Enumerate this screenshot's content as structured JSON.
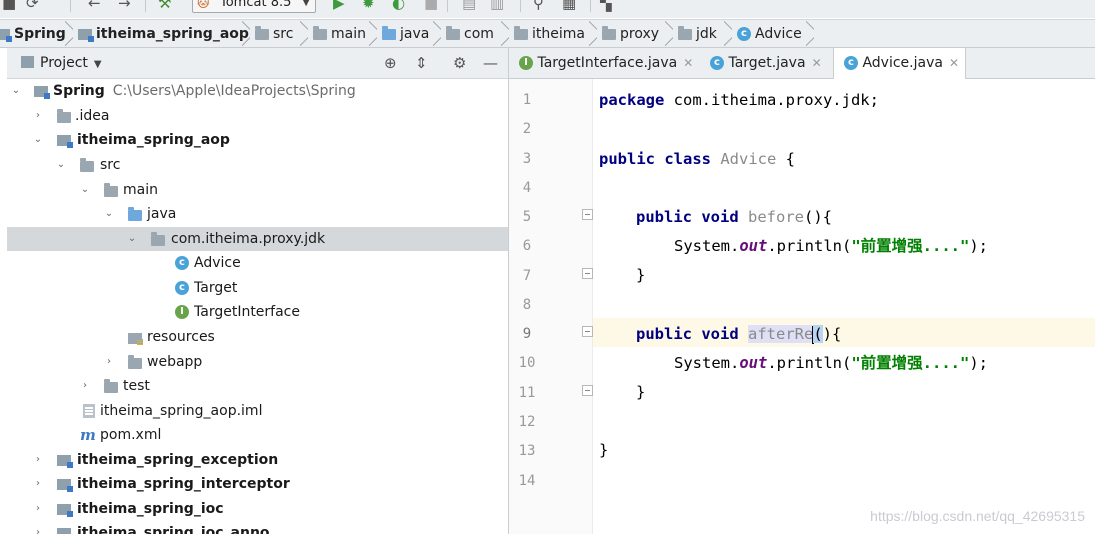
{
  "toolbar": {
    "run_config": "Tomcat 8.5",
    "icons": [
      "save-icon",
      "sync-icon",
      "undo-icon",
      "redo-icon",
      "build-icon",
      "tomcat-icon",
      "run-icon",
      "debug-icon",
      "coverage-icon",
      "stop-icon",
      "project-structure-icon",
      "sdk-icon",
      "search-icon",
      "structure-icon",
      "vcs-icon"
    ]
  },
  "breadcrumb": [
    {
      "label": "Spring",
      "icon": "module",
      "bold": true
    },
    {
      "label": "itheima_spring_aop",
      "icon": "module",
      "bold": true
    },
    {
      "label": "src",
      "icon": "folder"
    },
    {
      "label": "main",
      "icon": "folder"
    },
    {
      "label": "java",
      "icon": "folder-blue"
    },
    {
      "label": "com",
      "icon": "folder"
    },
    {
      "label": "itheima",
      "icon": "folder"
    },
    {
      "label": "proxy",
      "icon": "folder"
    },
    {
      "label": "jdk",
      "icon": "folder"
    },
    {
      "label": "Advice",
      "icon": "class"
    }
  ],
  "project_panel": {
    "title": "Project",
    "tree": [
      {
        "label": "Spring",
        "path": "C:\\Users\\Apple\\IdeaProjects\\Spring",
        "bold": true,
        "icon": "module",
        "expanded": true
      },
      {
        "label": ".idea",
        "icon": "folder",
        "expanded": false
      },
      {
        "label": "itheima_spring_aop",
        "bold": true,
        "icon": "module",
        "expanded": true
      },
      {
        "label": "src",
        "icon": "folder",
        "expanded": true
      },
      {
        "label": "main",
        "icon": "folder",
        "expanded": true
      },
      {
        "label": "java",
        "icon": "folder-blue",
        "expanded": true
      },
      {
        "label": "com.itheima.proxy.jdk",
        "icon": "package",
        "expanded": true,
        "selected": true
      },
      {
        "label": "Advice",
        "icon": "class"
      },
      {
        "label": "Target",
        "icon": "class"
      },
      {
        "label": "TargetInterface",
        "icon": "interface"
      },
      {
        "label": "resources",
        "icon": "resources"
      },
      {
        "label": "webapp",
        "icon": "folder",
        "expanded": false
      },
      {
        "label": "test",
        "icon": "folder",
        "expanded": false
      },
      {
        "label": "itheima_spring_aop.iml",
        "icon": "iml"
      },
      {
        "label": "pom.xml",
        "icon": "maven"
      },
      {
        "label": "itheima_spring_exception",
        "bold": true,
        "icon": "module",
        "expanded": false
      },
      {
        "label": "itheima_spring_interceptor",
        "bold": true,
        "icon": "module",
        "expanded": false
      },
      {
        "label": "itheima_spring_ioc",
        "bold": true,
        "icon": "module",
        "expanded": false
      },
      {
        "label": "itheima_spring_ioc_anno",
        "bold": true,
        "icon": "module",
        "expanded": false
      }
    ]
  },
  "editor": {
    "tabs": [
      {
        "label": "TargetInterface.java",
        "icon": "interface"
      },
      {
        "label": "Target.java",
        "icon": "class"
      },
      {
        "label": "Advice.java",
        "icon": "class",
        "active": true
      }
    ],
    "line_numbers": [
      "1",
      "2",
      "3",
      "4",
      "5",
      "6",
      "7",
      "8",
      "9",
      "10",
      "11",
      "12",
      "13",
      "14"
    ],
    "current_line": "9",
    "code": {
      "l1_kw": "package",
      "l1_rest": " com.itheima.proxy.jdk;",
      "l3_kw": "public class",
      "l3_name": "Advice",
      "l3_rest": " {",
      "l5_kw": "public void",
      "l5_name": "before",
      "l5_rest": "(){",
      "l6_a": "System.",
      "l6_field": "out",
      "l6_b": ".println(",
      "l6_str": "\"前置增强....\"",
      "l6_c": ");",
      "l7": "}",
      "l9_kw": "public void",
      "l9_name": "afterRe",
      "l9_paren": "(",
      "l9_rest": "){",
      "l10_a": "System.",
      "l10_field": "out",
      "l10_b": ".println(",
      "l10_str": "\"前置增强....\"",
      "l10_c": ");",
      "l11": "}",
      "l13": "}"
    }
  },
  "watermark": "https://blog.csdn.net/qq_42695315"
}
